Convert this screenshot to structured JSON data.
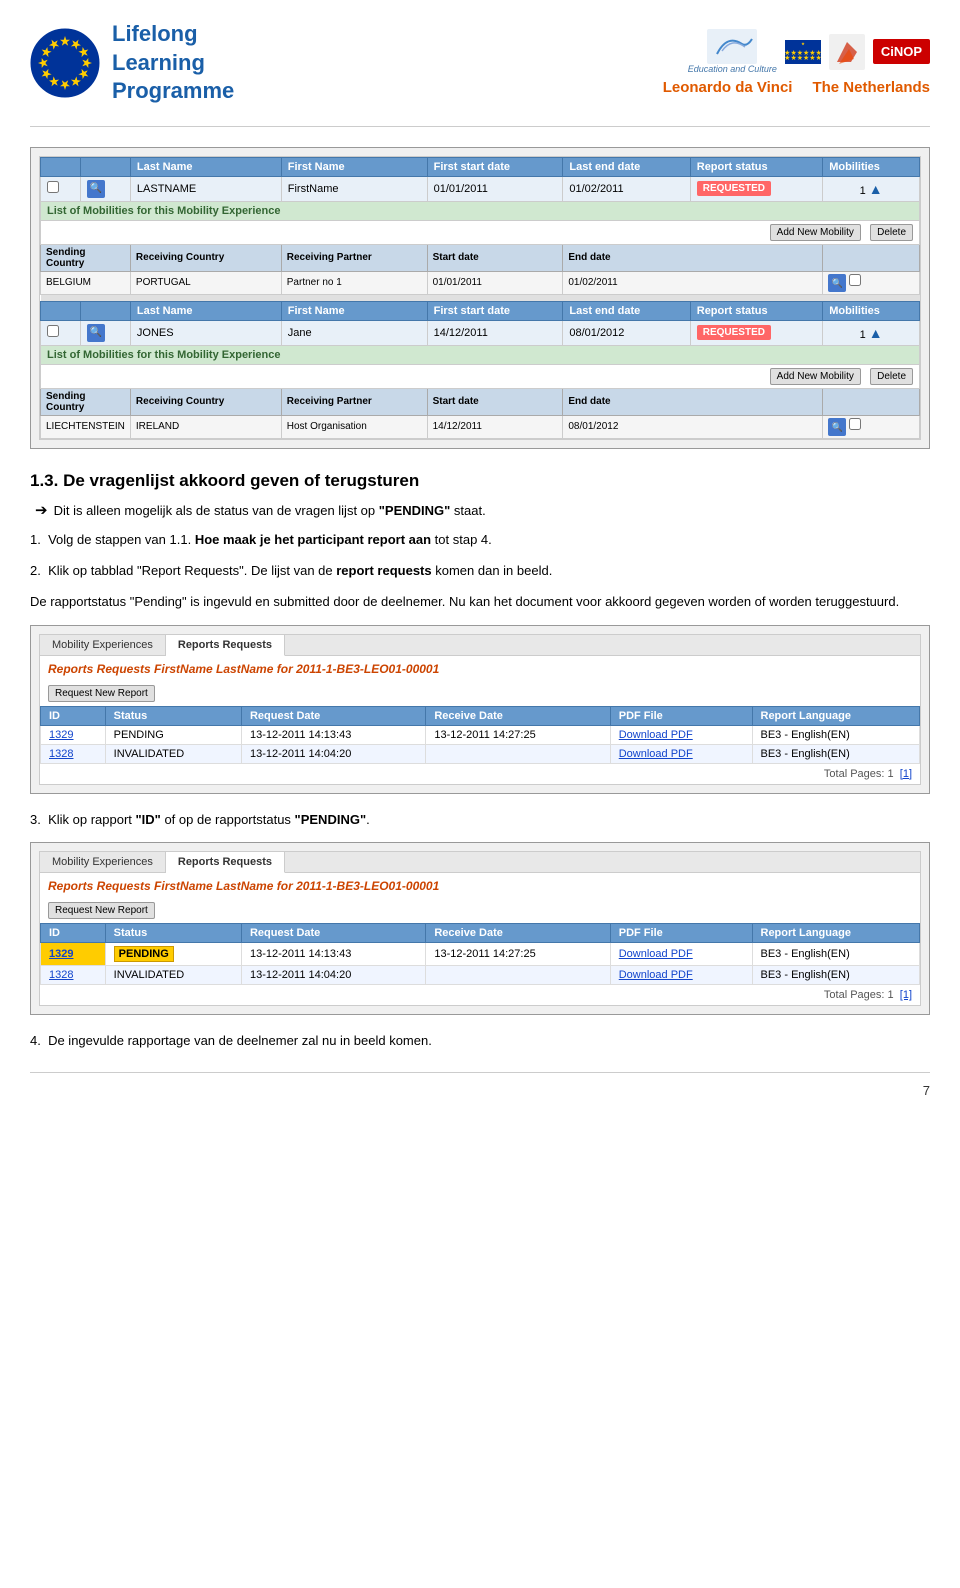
{
  "header": {
    "llp_line1": "Lifelong",
    "llp_line2": "Learning",
    "llp_line3": "Programme",
    "education_culture": "Education and Culture",
    "leonardo": "Leonardo da Vinci",
    "netherlands": "The Netherlands",
    "cinop": "CiNOP"
  },
  "top_screenshot": {
    "table1": {
      "headers": [
        "",
        "",
        "Last Name",
        "First Name",
        "First start date",
        "Last end date",
        "Report status",
        "Mobilities"
      ],
      "row1": {
        "lastname": "LASTNAME",
        "firstname": "FirstName",
        "start": "01/01/2011",
        "end": "01/02/2011",
        "status": "REQUESTED",
        "mobilities": "1"
      },
      "subheader": "List of Mobilities for this Mobility Experience",
      "sub_headers": [
        "Sending Country",
        "Receiving Country",
        "Receiving Partner",
        "Start date",
        "End date"
      ],
      "sub_row": {
        "sending": "BELGIUM",
        "receiving": "PORTUGAL",
        "partner": "Partner no 1",
        "start": "01/01/2011",
        "end": "01/02/2011"
      },
      "btn_new": "Add New Mobility",
      "btn_delete": "Delete"
    },
    "table2": {
      "row2": {
        "lastname": "JONES",
        "firstname": "Jane",
        "start": "14/12/2011",
        "end": "08/01/2012",
        "status": "REQUESTED",
        "mobilities": "1"
      },
      "subheader": "List of Mobilities for this Mobility Experience",
      "sub_row2": {
        "sending": "LIECHTENSTEIN",
        "receiving": "IRELAND",
        "partner": "Host Organisation",
        "start": "14/12/2011",
        "end": "08/01/2012"
      },
      "btn_new": "Add New Mobility",
      "btn_delete": "Delete"
    }
  },
  "section_title": "1.3. De vragenlijst akkoord geven of terugsturen",
  "bullet_text": "Dit is alleen mogelijk als de status van de vragen lijst op “PENDING” staat.",
  "step1_label": "1.",
  "step1_text": "Volg de stappen van 1.1. Hoe maak je het participant report aan tot stap 4.",
  "step2_label": "2.",
  "step2_text": "Klik op tabblad \"Report Requests\". De lijst van de ‘report requests’ komen dan in beeld.",
  "step2b_text": "De rapportstatus \"Pending\" is ingevuld en submitted door de deelnemer. Nu kan het document voor akkoord gegeven worden of worden teruggestuurd.",
  "reports_box1": {
    "tab1": "Mobility Experiences",
    "tab2": "Reports Requests",
    "title": "Reports Requests FirstName LastName for 2011-1-BE3-LEO01-00001",
    "btn_new_report": "Request New Report",
    "headers": [
      "ID",
      "Status",
      "Request Date",
      "Receive Date",
      "PDF File",
      "Report Language"
    ],
    "rows": [
      {
        "id": "1329",
        "status": "PENDING",
        "request_date": "13-12-2011 14:13:43",
        "receive_date": "13-12-2011 14:27:25",
        "pdf": "Download PDF",
        "language": "BE3 - English(EN)"
      },
      {
        "id": "1328",
        "status": "INVALIDATED",
        "request_date": "13-12-2011 14:04:20",
        "receive_date": "",
        "pdf": "Download PDF",
        "language": "BE3 - English(EN)"
      }
    ],
    "total": "Total Pages: 1",
    "page_links": "[1]"
  },
  "step3_label": "3.",
  "step3_text": "Klik op rapport “ID” of op de rapportstatus “PENDING”.",
  "reports_box2": {
    "tab1": "Mobility Experiences",
    "tab2": "Reports Requests",
    "title": "Reports Requests FirstName LastName for 2011-1-BE3-LEO01-00001",
    "btn_new_report": "Request New Report",
    "headers": [
      "ID",
      "Status",
      "Request Date",
      "Receive Date",
      "PDF File",
      "Report Language"
    ],
    "rows": [
      {
        "id": "1329",
        "status": "PENDING",
        "request_date": "13-12-2011 14:13:43",
        "receive_date": "13-12-2011 14:27:25",
        "pdf": "Download PDF",
        "language": "BE3 - English(EN)",
        "highlight": true
      },
      {
        "id": "1328",
        "status": "INVALIDATED",
        "request_date": "13-12-2011 14:04:20",
        "receive_date": "",
        "pdf": "Download PDF",
        "language": "BE3 - English(EN)"
      }
    ],
    "total": "Total Pages: 1",
    "page_links": "[1]"
  },
  "step4_label": "4.",
  "step4_text": "De ingevulde rapportage van de deelnemer zal nu in beeld komen.",
  "page_number": "7"
}
